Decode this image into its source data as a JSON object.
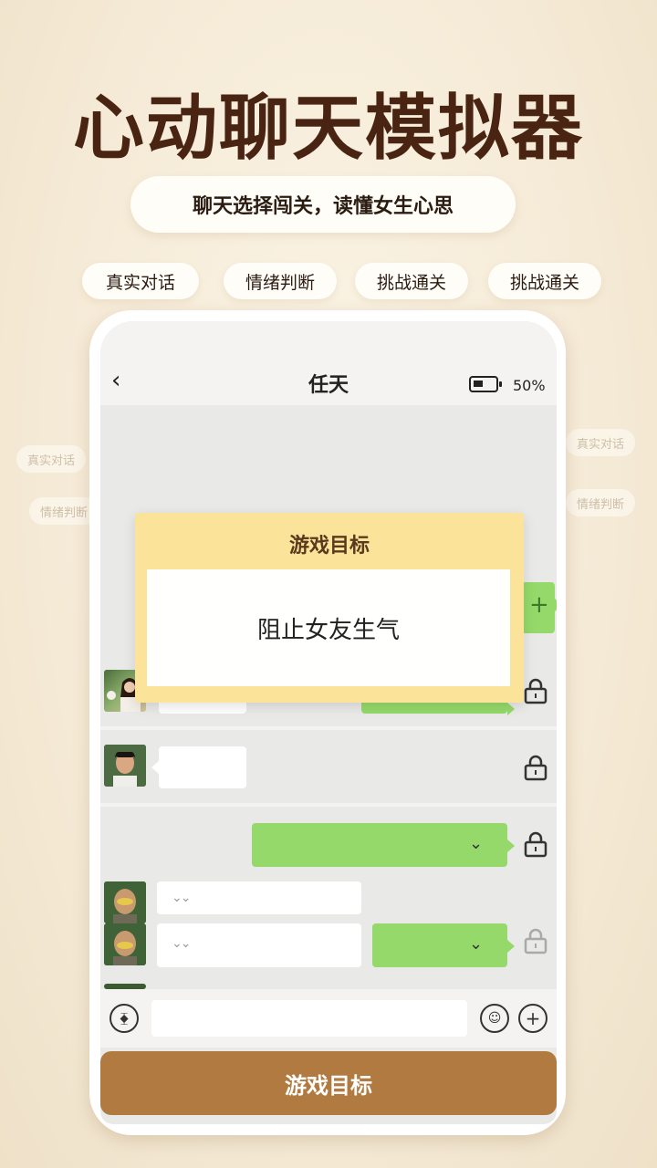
{
  "headline": "心动聊天模拟器",
  "subtitle": "聊天选择闯关，读懂女生心思",
  "tags": [
    "真实对话",
    "情绪判断",
    "挑战通关",
    "挑战通关"
  ],
  "ghost_tags": [
    "真实对话",
    "情绪判断",
    "真实对话",
    "情绪判断"
  ],
  "chat": {
    "back_icon": "chevron-left-icon",
    "title": "任天",
    "battery_text": "50%",
    "up_icon": "arrow-up-icon"
  },
  "modal": {
    "title": "游戏目标",
    "body": "阻止女友生气"
  },
  "bottom": {
    "voice_icon": "voice-icon",
    "emoji_icon": "emoji-icon",
    "plus_icon": "plus-icon",
    "game_button": "游戏目标"
  },
  "colors": {
    "headline": "#4a2412",
    "green_bubble": "#95d96a",
    "modal_bg": "#fbe49a",
    "game_button": "#b07a40"
  }
}
